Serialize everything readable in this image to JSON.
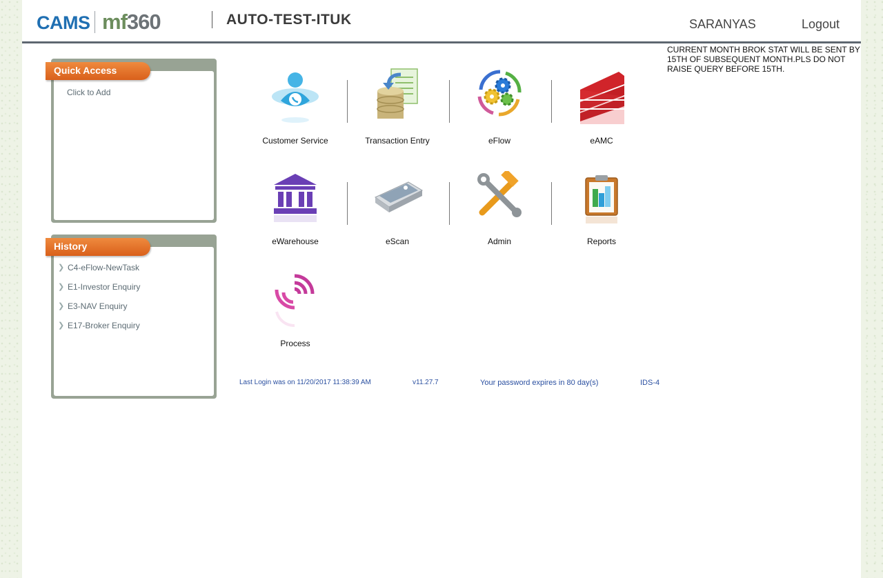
{
  "header": {
    "logo_cams": "CAMS",
    "logo_mf": "mf",
    "logo_num": "360",
    "app_title": "AUTO-TEST-ITUK",
    "user": "SARANYAS",
    "logout": "Logout"
  },
  "notice": "CURRENT MONTH BROK STAT WILL BE SENT BY 15TH OF SUBSEQUENT MONTH.PLS DO NOT RAISE QUERY BEFORE 15TH.",
  "quick_access": {
    "title": "Quick Access",
    "add_label": "Click to Add"
  },
  "history": {
    "title": "History",
    "items": [
      "C4-eFlow-NewTask",
      "E1-Investor Enquiry",
      "E3-NAV Enquiry",
      "E17-Broker Enquiry"
    ]
  },
  "apps": [
    {
      "label": "Customer Service",
      "icon": "customer-service-icon"
    },
    {
      "label": "Transaction Entry",
      "icon": "database-document-icon"
    },
    {
      "label": "eFlow",
      "icon": "gears-cycle-icon"
    },
    {
      "label": "eAMC",
      "icon": "stacked-bars-icon"
    },
    {
      "label": "eWarehouse",
      "icon": "bank-building-icon"
    },
    {
      "label": "eScan",
      "icon": "scanner-icon"
    },
    {
      "label": "Admin",
      "icon": "wrench-hammer-icon"
    },
    {
      "label": "Reports",
      "icon": "clipboard-chart-icon"
    },
    {
      "label": "Process",
      "icon": "signal-arcs-icon"
    }
  ],
  "footer": {
    "last_login": "Last Login was on 11/20/2017 11:38:39 AM",
    "version": "v11.27.7",
    "password_expiry": "Your password expires in 80 day(s)",
    "server": "IDS-4"
  },
  "colors": {
    "accent_orange": "#e0661f",
    "header_rule": "#5e6770",
    "panel_frame": "#98a394",
    "link_blue": "#2a4fa0"
  }
}
